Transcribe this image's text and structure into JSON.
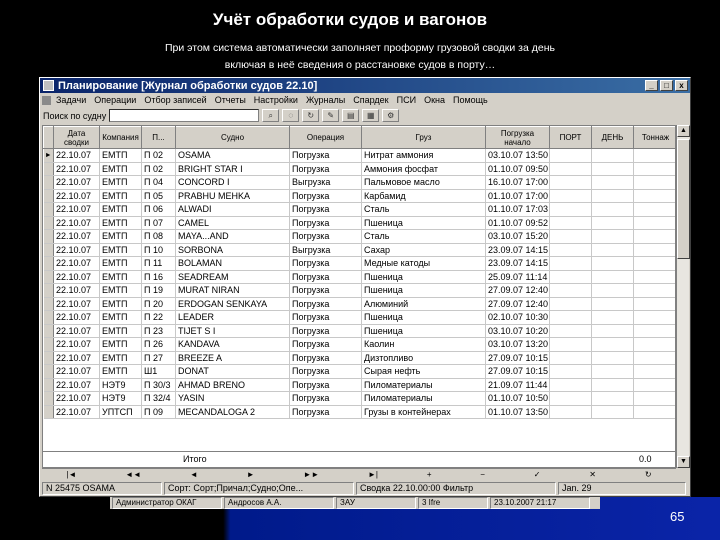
{
  "slide": {
    "title": "Учёт обработки судов и вагонов",
    "subtitle1": "При этом система автоматически заполняет проформу грузовой сводки за день",
    "subtitle2": "включая в неё сведения о расстановке судов в порту…",
    "page_number": "65"
  },
  "window": {
    "title": "Планирование   [Журнал обработки судов 22.10]",
    "min": "_",
    "max": "□",
    "close": "x"
  },
  "menu": [
    "Задачи",
    "Операции",
    "Отбор записей",
    "Отчеты",
    "Настройки",
    "Журналы",
    "Спардек",
    "ПСИ",
    "Окна",
    "Помощь"
  ],
  "search": {
    "label": "Поиск по судну",
    "value": ""
  },
  "columns": [
    "Дата сводки",
    "Компания",
    "П...",
    "Судно",
    "Операция",
    "Груз",
    "Погрузка начало",
    "",
    "Тоннаж"
  ],
  "sub_columns": {
    "c7": "ПОРТ",
    "c8": "ДЕНЬ"
  },
  "rows": [
    [
      "22.10.07",
      "ЕМТП",
      "П 02",
      "OSAMA",
      "Погрузка",
      "Нитрат аммония",
      "03.10.07 13:50"
    ],
    [
      "22.10.07",
      "ЕМТП",
      "П 02",
      "BRIGHT STAR I",
      "Погрузка",
      "Аммония фосфат",
      "01.10.07 09:50"
    ],
    [
      "22.10.07",
      "ЕМТП",
      "П 04",
      "CONCORD I",
      "Выгрузка",
      "Пальмовое масло",
      "16.10.07 17:00"
    ],
    [
      "22.10.07",
      "ЕМТП",
      "П 05",
      "PRABHU MEHKA",
      "Погрузка",
      "Карбамид",
      "01.10.07 17:00"
    ],
    [
      "22.10.07",
      "ЕМТП",
      "П 06",
      "ALWADI",
      "Погрузка",
      "Сталь",
      "01.10.07 17:03"
    ],
    [
      "22.10.07",
      "ЕМТП",
      "П 07",
      "CAMEL",
      "Погрузка",
      "Пшеница",
      "01.10.07 09:52"
    ],
    [
      "22.10.07",
      "ЕМТП",
      "П 08",
      "MAYA...AND",
      "Погрузка",
      "Сталь",
      "03.10.07 15:20"
    ],
    [
      "22.10.07",
      "ЕМТП",
      "П 10",
      "SORBONA",
      "Выгрузка",
      "Сахар",
      "23.09.07 14:15"
    ],
    [
      "22.10.07",
      "ЕМТП",
      "П 11",
      "BOLAMAN",
      "Погрузка",
      "Медные катоды",
      "23.09.07 14:15"
    ],
    [
      "22.10.07",
      "ЕМТП",
      "П 16",
      "SEADREAM",
      "Погрузка",
      "Пшеница",
      "25.09.07 11:14"
    ],
    [
      "22.10.07",
      "ЕМТП",
      "П 19",
      "MURAT NIRAN",
      "Погрузка",
      "Пшеница",
      "27.09.07 12:40"
    ],
    [
      "22.10.07",
      "ЕМТП",
      "П 20",
      "ERDOGAN SENKAYA",
      "Погрузка",
      "Алюминий",
      "27.09.07 12:40"
    ],
    [
      "22.10.07",
      "ЕМТП",
      "П 22",
      "LEADER",
      "Погрузка",
      "Пшеница",
      "02.10.07 10:30"
    ],
    [
      "22.10.07",
      "ЕМТП",
      "П 23",
      "TIJET S I",
      "Погрузка",
      "Пшеница",
      "03.10.07 10:20"
    ],
    [
      "22.10.07",
      "ЕМТП",
      "П 26",
      "KANDAVA",
      "Погрузка",
      "Каолин",
      "03.10.07 13:20"
    ],
    [
      "22.10.07",
      "ЕМТП",
      "П 27",
      "BREEZE A",
      "Погрузка",
      "Дизтопливо",
      "27.09.07 10:15"
    ],
    [
      "22.10.07",
      "ЕМТП",
      "Ш1",
      "DONAT",
      "Погрузка",
      "Сырая нефть",
      "27.09.07 10:15"
    ],
    [
      "22.10.07",
      "НЭТ9",
      "П 30/3",
      "AHMAD BRENO",
      "Погрузка",
      "Пиломатериалы",
      "21.09.07 11:44"
    ],
    [
      "22.10.07",
      "НЭТ9",
      "П 32/4",
      "YASIN",
      "Погрузка",
      "Пиломатериалы",
      "01.10.07 10:50"
    ],
    [
      "22.10.07",
      "УПТСП",
      "П 09",
      "MECANDALOGA 2",
      "Погрузка",
      "Грузы в контейнерах",
      "01.10.07 13:50"
    ]
  ],
  "selected_indicator": "►",
  "total": {
    "label": "Итого",
    "value": "0.0"
  },
  "hscroll": [
    "|◄",
    "◄◄",
    "◄",
    "►",
    "►►",
    "►|",
    "+",
    "−",
    "✓",
    "✕",
    "↻"
  ],
  "status": [
    "N 25475 OSAMA",
    "Сорт: Сорт;Причал;Судно;Опе...",
    "Сводка 22.10.00:00 Фильтр",
    "Jan. 29"
  ],
  "bottom_strip": [
    "Администратор ОКАГ",
    "Андросов А.А.",
    "ЗАУ",
    "3 Ifre",
    "23.10.2007 21:17"
  ]
}
